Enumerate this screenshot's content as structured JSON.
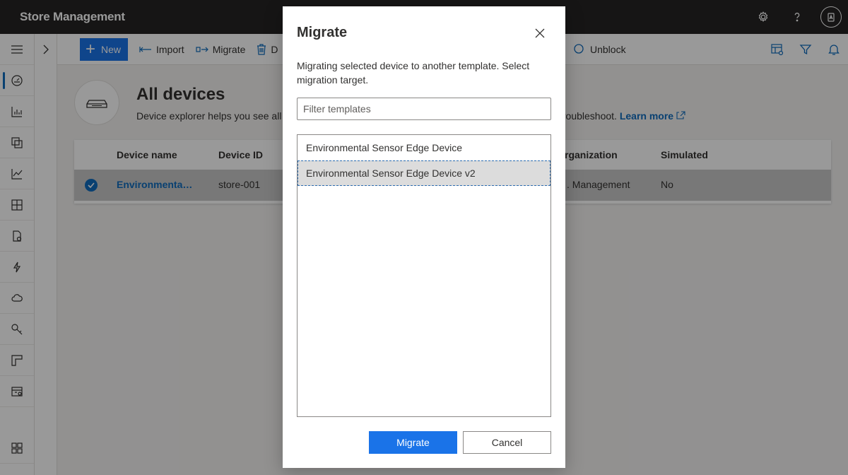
{
  "app": {
    "title": "Store Management"
  },
  "topbar": {
    "icons": [
      "gear-icon",
      "help-icon",
      "avatar-icon"
    ]
  },
  "sidenav": {
    "items": [
      "menu-icon",
      "dashboard-icon",
      "analytics-icon",
      "devices-icon",
      "chart-icon",
      "grid-icon",
      "document-icon",
      "rules-icon",
      "cloud-icon",
      "key-icon",
      "template-icon",
      "jobs-icon",
      "apps-icon"
    ],
    "active_index": 1
  },
  "commandbar": {
    "new_label": "New",
    "import_label": "Import",
    "migrate_label": "Migrate",
    "delete_label_partial": "D",
    "unblock_label": "Unblock"
  },
  "page": {
    "title": "All devices",
    "description": "Device explorer helps you see all y",
    "description_tail": "troubleshoot.",
    "learn_more": "Learn more"
  },
  "grid": {
    "columns": [
      "Device name",
      "Device ID",
      "rganization",
      "Simulated"
    ],
    "rows": [
      {
        "device_name": "Environmenta…",
        "device_id": "store-001",
        "organization": ". Management",
        "simulated": "No",
        "selected": true
      }
    ]
  },
  "dialog": {
    "title": "Migrate",
    "description": "Migrating selected device to another template. Select migration target.",
    "filter_placeholder": "Filter templates",
    "options": [
      "Environmental Sensor Edge Device",
      "Environmental Sensor Edge Device v2"
    ],
    "selected_option": "Environmental Sensor Edge Device v2",
    "primary_label": "Migrate",
    "secondary_label": "Cancel"
  },
  "colors": {
    "accent": "#1a73e8",
    "link": "#0f6cbd",
    "topbar": "#252423"
  }
}
